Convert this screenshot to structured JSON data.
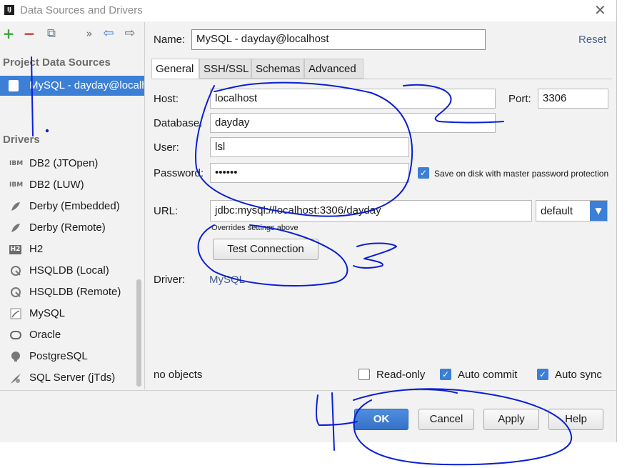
{
  "window": {
    "title": "Data Sources and Drivers",
    "app_icon_text": "IJ"
  },
  "toolbar": {
    "add": "+",
    "remove": "−",
    "duplicate": "⧉",
    "more": "»",
    "back": "⇦",
    "forward": "⇨"
  },
  "sidebar": {
    "project_header": "Project Data Sources",
    "selected_source": "MySQL - dayday@localhost",
    "drivers_header": "Drivers",
    "drivers": [
      {
        "label": "DB2 (JTOpen)",
        "icon": "IBM"
      },
      {
        "label": "DB2 (LUW)",
        "icon": "IBM"
      },
      {
        "label": "Derby (Embedded)",
        "icon": "derby-icon"
      },
      {
        "label": "Derby (Remote)",
        "icon": "derby-icon"
      },
      {
        "label": "H2",
        "icon": "H2"
      },
      {
        "label": "HSQLDB (Local)",
        "icon": "hsqldb-icon"
      },
      {
        "label": "HSQLDB (Remote)",
        "icon": "hsqldb-icon"
      },
      {
        "label": "MySQL",
        "icon": "mysql-icon"
      },
      {
        "label": "Oracle",
        "icon": "oracle-icon"
      },
      {
        "label": "PostgreSQL",
        "icon": "postgresql-icon"
      },
      {
        "label": "SQL Server (jTds)",
        "icon": "sqlserver-icon"
      }
    ]
  },
  "form": {
    "name_label": "Name:",
    "name_value": "MySQL - dayday@localhost",
    "reset": "Reset",
    "tabs": [
      "General",
      "SSH/SSL",
      "Schemas",
      "Advanced"
    ],
    "host_label": "Host:",
    "host_value": "localhost",
    "port_label": "Port:",
    "port_value": "3306",
    "database_label": "Database:",
    "database_value": "dayday",
    "user_label": "User:",
    "user_value": "lsl",
    "password_label": "Password:",
    "password_value": "••••••",
    "save_label": "Save on disk with master password protection",
    "url_label": "URL:",
    "url_value": "jdbc:mysql://localhost:3306/dayday",
    "url_mode": "default",
    "url_hint": "Overrides settings above",
    "test_connection": "Test Connection",
    "driver_label": "Driver:",
    "driver_value": "MySQL"
  },
  "status": {
    "objects": "no objects",
    "read_only": "Read-only",
    "auto_commit": "Auto commit",
    "auto_sync": "Auto sync"
  },
  "buttons": {
    "ok": "OK",
    "cancel": "Cancel",
    "apply": "Apply",
    "help": "Help"
  },
  "colors": {
    "accent": "#3c7fd6",
    "ink": "#0a1fd6",
    "link": "#4a5f8d"
  }
}
